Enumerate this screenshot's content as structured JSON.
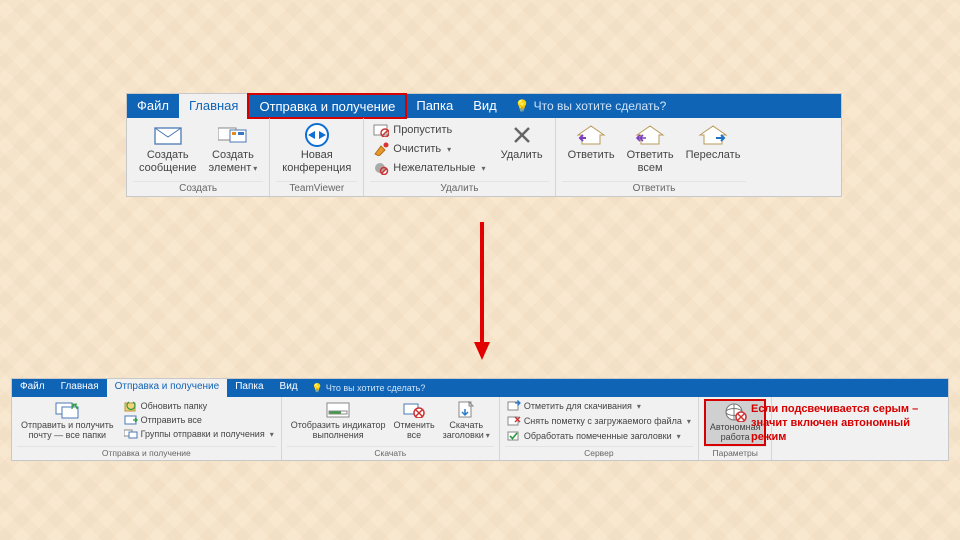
{
  "top": {
    "tabs": {
      "file": "Файл",
      "home": "Главная",
      "sendrecv": "Отправка и получение",
      "folder": "Папка",
      "view": "Вид"
    },
    "tellme": "Что вы хотите сделать?",
    "groups": {
      "create": {
        "label": "Создать",
        "new_msg": "Создать\nсообщение",
        "new_item": "Создать\nэлемент"
      },
      "teamviewer": {
        "label": "TeamViewer",
        "meeting": "Новая\nконференция"
      },
      "delete": {
        "label": "Удалить",
        "ignore": "Пропустить",
        "clean": "Очистить",
        "junk": "Нежелательные",
        "delete": "Удалить"
      },
      "respond": {
        "label": "Ответить",
        "reply": "Ответить",
        "reply_all": "Ответить\nвсем",
        "forward": "Переслать"
      }
    }
  },
  "bottom": {
    "tabs": {
      "file": "Файл",
      "home": "Главная",
      "sendrecv": "Отправка и получение",
      "folder": "Папка",
      "view": "Вид"
    },
    "tellme": "Что вы хотите сделать?",
    "groups": {
      "sendrecv": {
        "label": "Отправка и получение",
        "all": "Отправить и получить\nпочту — все папки",
        "update_folder": "Обновить папку",
        "send_all": "Отправить все",
        "groups": "Группы отправки и получения"
      },
      "download": {
        "label": "Скачать",
        "progress": "Отобразить индикатор\nвыполнения",
        "cancel": "Отменить\nвсе",
        "headers": "Скачать\nзаголовки"
      },
      "server": {
        "label": "Сервер",
        "mark": "Отметить для скачивания",
        "unmark": "Снять пометку с загружаемого файла",
        "process": "Обработать помеченные заголовки"
      },
      "params": {
        "label": "Параметры",
        "offline": "Автономная\nработа"
      }
    }
  },
  "callout": "Если подсвечивается серым – значит включен автономный режим"
}
